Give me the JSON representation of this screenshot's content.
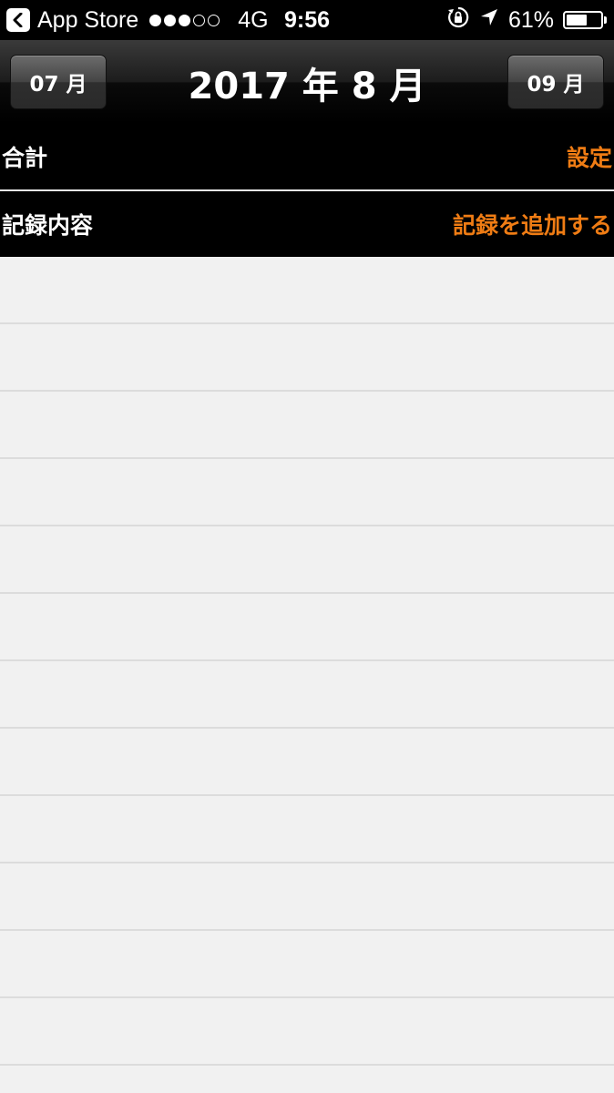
{
  "status_bar": {
    "back_app": "App Store",
    "signal_filled": 3,
    "signal_total": 5,
    "network": "4G",
    "time": "9:56",
    "battery_percent": "61%",
    "battery_level": 0.61,
    "icons": [
      "back-chevron-icon",
      "rotation-lock-icon",
      "location-arrow-icon",
      "battery-icon"
    ]
  },
  "nav": {
    "prev_month": "07 月",
    "title": "2017 年 8 月",
    "next_month": "09 月"
  },
  "sections": {
    "total": {
      "label": "合計",
      "action": "設定"
    },
    "records": {
      "label": "記録内容",
      "action": "記録を追加する"
    }
  },
  "list": {
    "row_count": 12
  },
  "colors": {
    "accent": "#ef7c14",
    "background": "#f1f1f1",
    "separator": "#dcdcdc"
  }
}
